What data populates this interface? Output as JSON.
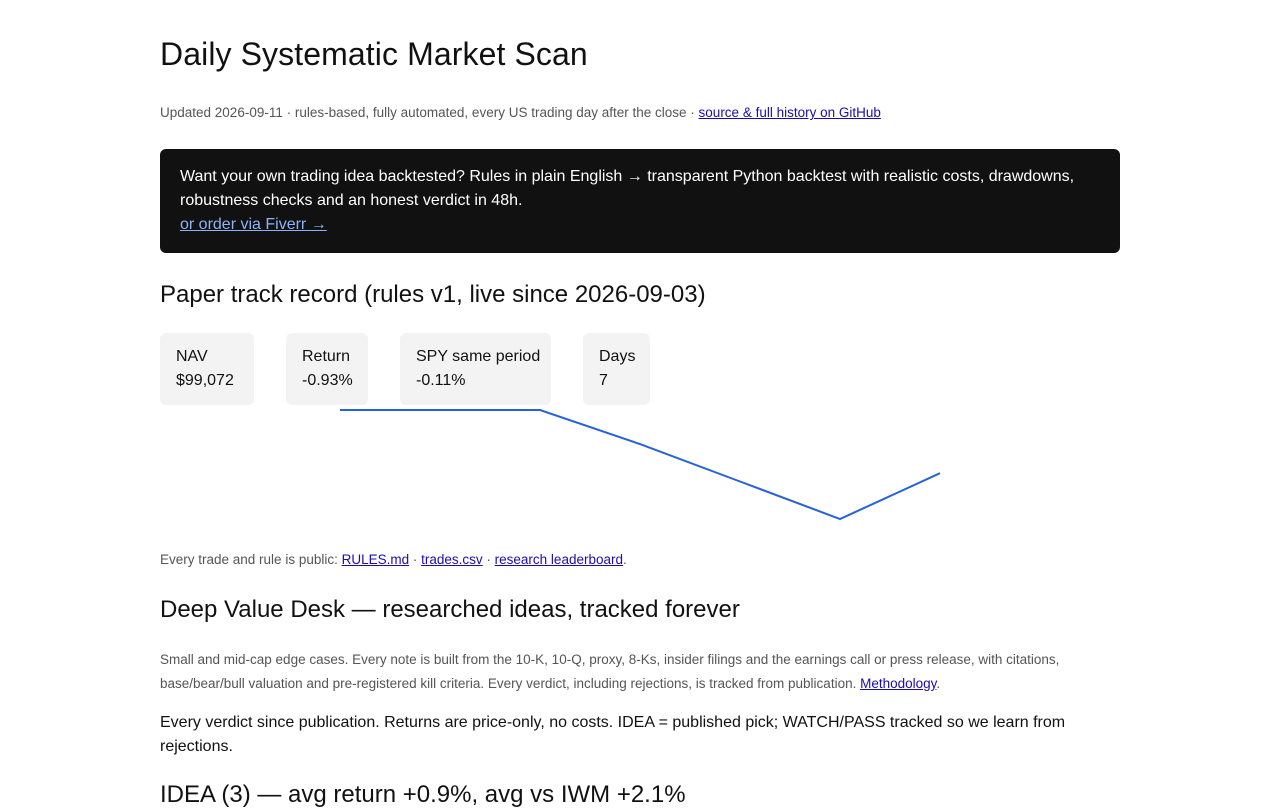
{
  "page": {
    "title": "Daily Systematic Market Scan",
    "meta_text": "Updated 2026-09-11 · rules-based, fully automated, every US trading day after the close · ",
    "meta_link": "source & full history on GitHub"
  },
  "cta": {
    "text": "Want your own trading idea backtested? Rules in plain English → transparent Python backtest with realistic costs, drawdowns, robustness checks and an honest verdict in 48h.",
    "link": "or order via Fiverr →"
  },
  "track_record": {
    "heading": "Paper track record (rules v1, live since 2026-09-03)",
    "stats": [
      {
        "label": "NAV",
        "value": "$99,072"
      },
      {
        "label": "Return",
        "value": "-0.93%"
      },
      {
        "label": "SPY same period",
        "value": "-0.11%"
      },
      {
        "label": "Days",
        "value": "7"
      }
    ]
  },
  "chart_data": {
    "type": "line",
    "x": [
      1,
      2,
      3,
      4,
      5,
      6,
      7
    ],
    "series": [
      {
        "values": [
          100000,
          100000,
          100000,
          99500,
          98950,
          98400,
          99072
        ]
      }
    ],
    "ylim": [
      98400,
      100000
    ],
    "color": "#2563d9",
    "grid": false,
    "axes": false
  },
  "public": {
    "prefix": "Every trade and rule is public: ",
    "link1": "RULES.md",
    "sep1": " · ",
    "link2": "trades.csv",
    "sep2": " · ",
    "link3": "research leaderboard",
    "suffix": "."
  },
  "desk": {
    "heading": "Deep Value Desk — researched ideas, tracked forever",
    "description": "Small and mid-cap edge cases. Every note is built from the 10-K, 10-Q, proxy, 8-Ks, insider filings and the earnings call or press release, with citations, base/bear/bull valuation and pre-registered kill criteria. Every verdict, including rejections, is tracked from publication. ",
    "methodology_link": "Methodology",
    "description_end": ".",
    "verdict_text": "Every verdict since publication. Returns are price-only, no costs. IDEA = published pick; WATCH/PASS tracked so we learn from rejections.",
    "idea_heading": "IDEA (3) — avg return +0.9%, avg vs IWM +2.1%"
  }
}
